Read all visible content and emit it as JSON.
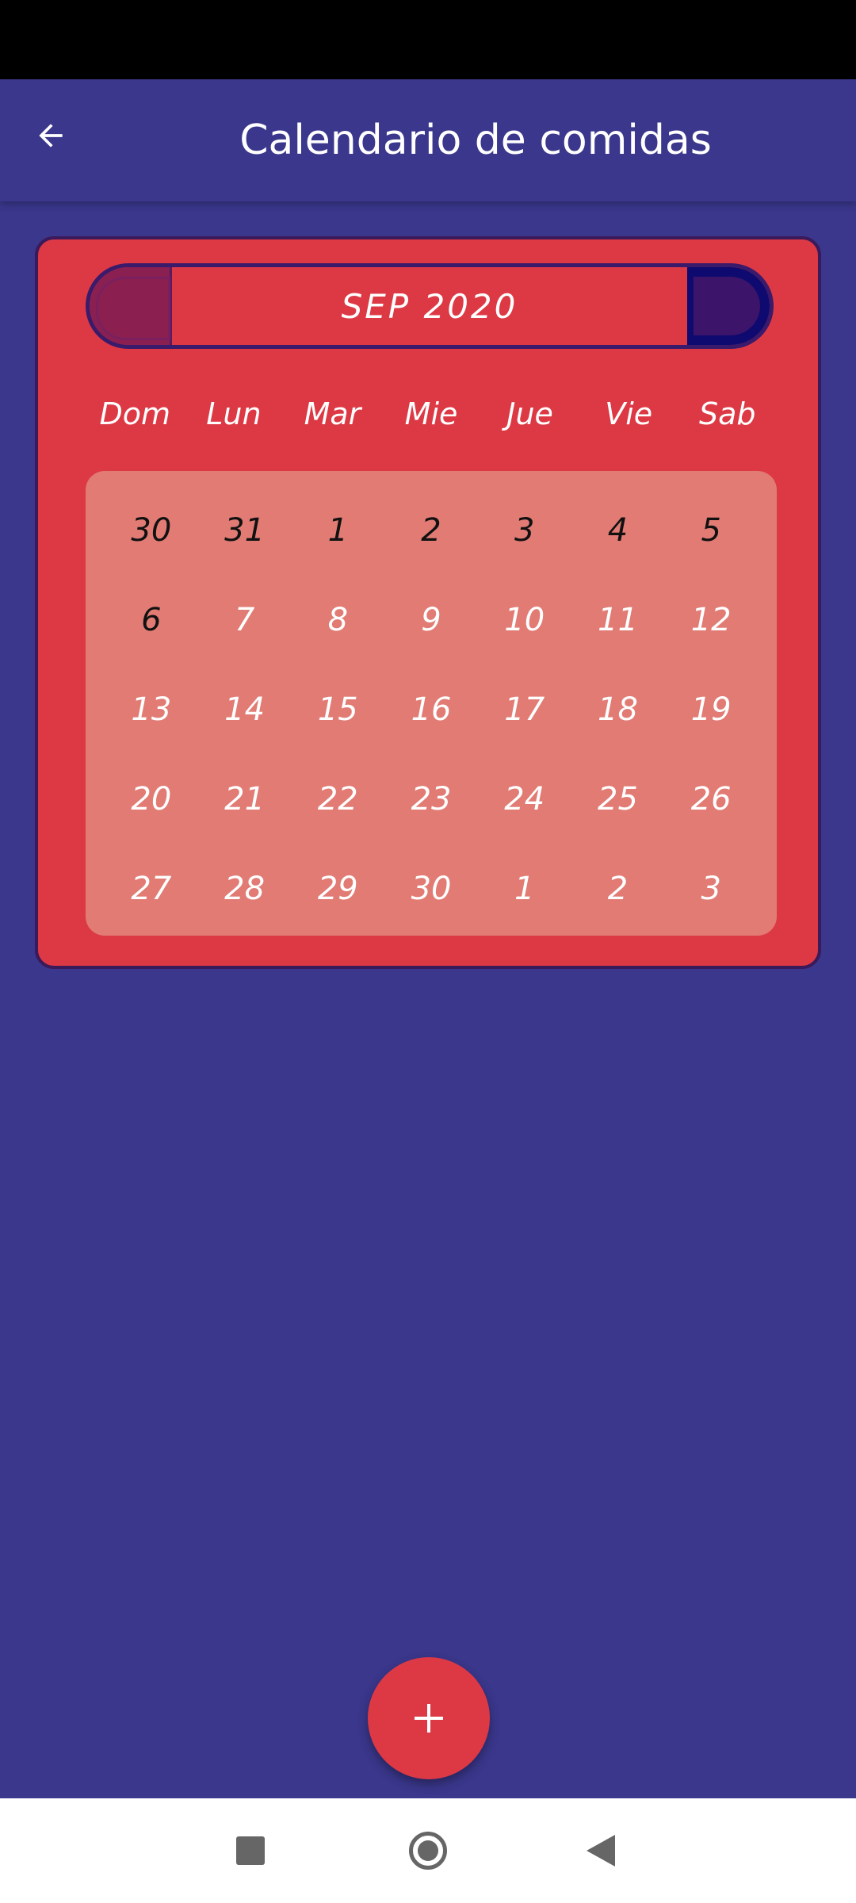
{
  "app_bar": {
    "title": "Calendario de comidas",
    "back_icon": "arrow-back-icon"
  },
  "calendar": {
    "month_label": "SEP 2020",
    "weekdays": [
      "Dom",
      "Lun",
      "Mar",
      "Mie",
      "Jue",
      "Vie",
      "Sab"
    ],
    "weeks": [
      [
        "30",
        "31",
        "1",
        "2",
        "3",
        "4",
        "5"
      ],
      [
        "6",
        "7",
        "8",
        "9",
        "10",
        "11",
        "12"
      ],
      [
        "13",
        "14",
        "15",
        "16",
        "17",
        "18",
        "19"
      ],
      [
        "20",
        "21",
        "22",
        "23",
        "24",
        "25",
        "26"
      ],
      [
        "27",
        "28",
        "29",
        "30",
        "1",
        "2",
        "3"
      ]
    ]
  },
  "fab": {
    "icon": "plus-icon"
  },
  "colors": {
    "background": "#3a378c",
    "accent": "#dd3945",
    "grid": "#e17b74"
  }
}
